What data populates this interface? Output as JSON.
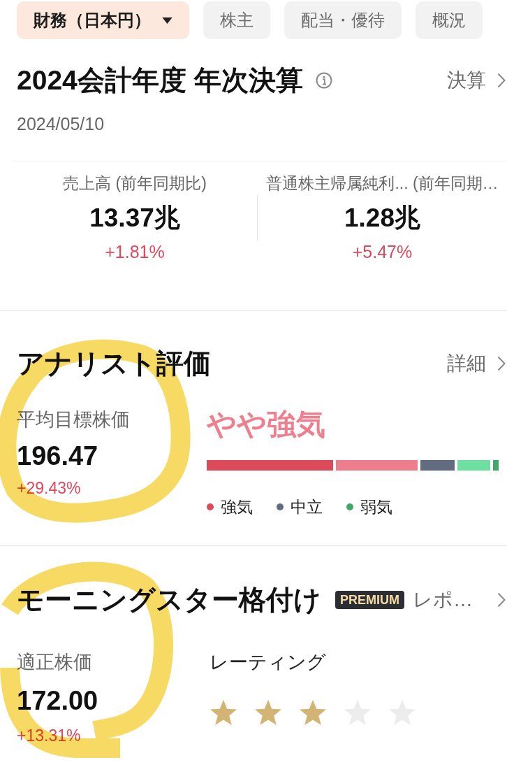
{
  "tabs": [
    {
      "label": "財務（日本円）",
      "selected": true,
      "dropdown": true
    },
    {
      "label": "株主",
      "selected": false,
      "dropdown": false
    },
    {
      "label": "配当・優待",
      "selected": false,
      "dropdown": false
    },
    {
      "label": "概況",
      "selected": false,
      "dropdown": false
    }
  ],
  "report": {
    "title": "2024会計年度 年次決算",
    "link": "決算",
    "date": "2024/05/10",
    "metrics": [
      {
        "label": "売上高 (前年同期比)",
        "value": "13.37兆",
        "change": "+1.81%"
      },
      {
        "label": "普通株主帰属純利... (前年同期…",
        "value": "1.28兆",
        "change": "+5.47%"
      }
    ]
  },
  "analyst": {
    "title": "アナリスト評価",
    "link": "詳細",
    "target_label": "平均目標株価",
    "target_value": "196.47",
    "target_change": "+29.43%",
    "rating": "やや強気",
    "legend": [
      {
        "label": "強気",
        "color": "#dc4b5a"
      },
      {
        "label": "中立",
        "color": "#626b80"
      },
      {
        "label": "弱気",
        "color": "#41a86a"
      }
    ]
  },
  "morningstar": {
    "title": "モーニングスター格付け",
    "badge": "PREMIUM",
    "link": "レポ…",
    "fair_label": "適正株価",
    "fair_value": "172.00",
    "fair_change": "+13.31%",
    "rating_label": "レーティング",
    "stars": 3
  }
}
